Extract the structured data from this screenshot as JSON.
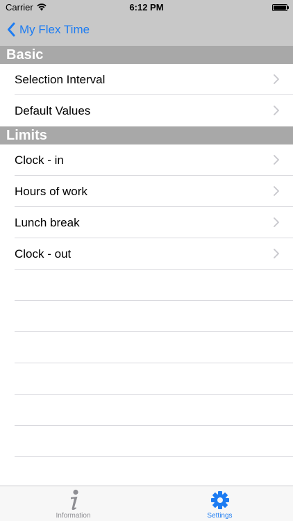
{
  "status": {
    "carrier": "Carrier",
    "time": "6:12 PM"
  },
  "nav": {
    "back_label": "My Flex Time"
  },
  "sections": [
    {
      "title": "Basic",
      "items": [
        {
          "label": "Selection Interval"
        },
        {
          "label": "Default Values"
        }
      ]
    },
    {
      "title": "Limits",
      "items": [
        {
          "label": "Clock - in"
        },
        {
          "label": "Hours of work"
        },
        {
          "label": "Lunch break"
        },
        {
          "label": "Clock - out"
        }
      ]
    }
  ],
  "tabbar": {
    "tabs": [
      {
        "label": "Information",
        "icon": "info-icon",
        "selected": false
      },
      {
        "label": "Settings",
        "icon": "gear-icon",
        "selected": true
      }
    ]
  },
  "colors": {
    "accent": "#1d7cf2",
    "section_header": "#a8a8a8",
    "topbar": "#c8c8c8",
    "tab_inactive": "#8e8e93"
  }
}
